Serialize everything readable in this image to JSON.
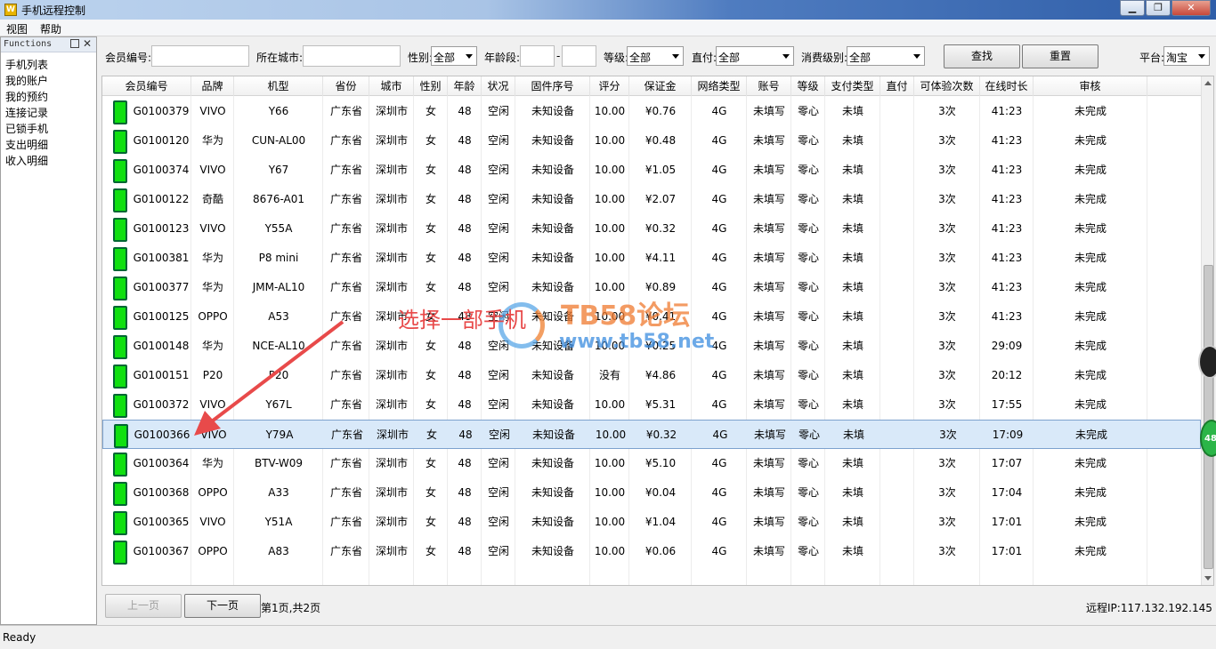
{
  "window": {
    "app_icon_text": "W",
    "title": "手机远程控制"
  },
  "menu": [
    "视图",
    "帮助"
  ],
  "left_panel": {
    "title": "Functions",
    "pin": "",
    "close": "✕",
    "items": [
      "手机列表",
      "我的账户",
      "我的预约",
      "连接记录",
      "已锁手机",
      "支出明细",
      "收入明细"
    ]
  },
  "filters": {
    "member_id_label": "会员编号:",
    "member_id_value": "",
    "city_label": "所在城市:",
    "city_value": "",
    "gender_label": "性别:",
    "gender_value": "全部",
    "age_label": "年龄段:",
    "age_from": "",
    "age_sep": "-",
    "age_to": "",
    "level_label": "等级:",
    "level_value": "全部",
    "direct_pay_label": "直付:",
    "direct_pay_value": "全部",
    "spend_level_label": "消费级别:",
    "spend_level_value": "全部",
    "search_button": "查找",
    "reset_button": "重置",
    "platform_label": "平台:",
    "platform_value": "淘宝"
  },
  "table": {
    "columns": [
      "会员编号",
      "品牌",
      "机型",
      "省份",
      "城市",
      "性别",
      "年龄",
      "状况",
      "固件序号",
      "评分",
      "保证金",
      "网络类型",
      "账号",
      "等级",
      "支付类型",
      "直付",
      "可体验次数",
      "在线时长",
      "审核"
    ],
    "selected_index": 11,
    "rows": [
      [
        "G0100379",
        "VIVO",
        "Y66",
        "广东省",
        "深圳市",
        "女",
        "48",
        "空闲",
        "未知设备",
        "10.00",
        "¥0.76",
        "4G",
        "未填写",
        "零心",
        "未填",
        "",
        "3次",
        "41:23",
        "未完成"
      ],
      [
        "G0100120",
        "华为",
        "CUN-AL00",
        "广东省",
        "深圳市",
        "女",
        "48",
        "空闲",
        "未知设备",
        "10.00",
        "¥0.48",
        "4G",
        "未填写",
        "零心",
        "未填",
        "",
        "3次",
        "41:23",
        "未完成"
      ],
      [
        "G0100374",
        "VIVO",
        "Y67",
        "广东省",
        "深圳市",
        "女",
        "48",
        "空闲",
        "未知设备",
        "10.00",
        "¥1.05",
        "4G",
        "未填写",
        "零心",
        "未填",
        "",
        "3次",
        "41:23",
        "未完成"
      ],
      [
        "G0100122",
        "奇酷",
        "8676-A01",
        "广东省",
        "深圳市",
        "女",
        "48",
        "空闲",
        "未知设备",
        "10.00",
        "¥2.07",
        "4G",
        "未填写",
        "零心",
        "未填",
        "",
        "3次",
        "41:23",
        "未完成"
      ],
      [
        "G0100123",
        "VIVO",
        "Y55A",
        "广东省",
        "深圳市",
        "女",
        "48",
        "空闲",
        "未知设备",
        "10.00",
        "¥0.32",
        "4G",
        "未填写",
        "零心",
        "未填",
        "",
        "3次",
        "41:23",
        "未完成"
      ],
      [
        "G0100381",
        "华为",
        "P8 mini",
        "广东省",
        "深圳市",
        "女",
        "48",
        "空闲",
        "未知设备",
        "10.00",
        "¥4.11",
        "4G",
        "未填写",
        "零心",
        "未填",
        "",
        "3次",
        "41:23",
        "未完成"
      ],
      [
        "G0100377",
        "华为",
        "JMM-AL10",
        "广东省",
        "深圳市",
        "女",
        "48",
        "空闲",
        "未知设备",
        "10.00",
        "¥0.89",
        "4G",
        "未填写",
        "零心",
        "未填",
        "",
        "3次",
        "41:23",
        "未完成"
      ],
      [
        "G0100125",
        "OPPO",
        "A53",
        "广东省",
        "深圳市",
        "女",
        "48",
        "空闲",
        "未知设备",
        "10.00",
        "¥0.41",
        "4G",
        "未填写",
        "零心",
        "未填",
        "",
        "3次",
        "41:23",
        "未完成"
      ],
      [
        "G0100148",
        "华为",
        "NCE-AL10",
        "广东省",
        "深圳市",
        "女",
        "48",
        "空闲",
        "未知设备",
        "10.00",
        "¥0.25",
        "4G",
        "未填写",
        "零心",
        "未填",
        "",
        "3次",
        "29:09",
        "未完成"
      ],
      [
        "G0100151",
        "P20",
        "P20",
        "广东省",
        "深圳市",
        "女",
        "48",
        "空闲",
        "未知设备",
        "没有",
        "¥4.86",
        "4G",
        "未填写",
        "零心",
        "未填",
        "",
        "3次",
        "20:12",
        "未完成"
      ],
      [
        "G0100372",
        "VIVO",
        "Y67L",
        "广东省",
        "深圳市",
        "女",
        "48",
        "空闲",
        "未知设备",
        "10.00",
        "¥5.31",
        "4G",
        "未填写",
        "零心",
        "未填",
        "",
        "3次",
        "17:55",
        "未完成"
      ],
      [
        "G0100366",
        "VIVO",
        "Y79A",
        "广东省",
        "深圳市",
        "女",
        "48",
        "空闲",
        "未知设备",
        "10.00",
        "¥0.32",
        "4G",
        "未填写",
        "零心",
        "未填",
        "",
        "3次",
        "17:09",
        "未完成"
      ],
      [
        "G0100364",
        "华为",
        "BTV-W09",
        "广东省",
        "深圳市",
        "女",
        "48",
        "空闲",
        "未知设备",
        "10.00",
        "¥5.10",
        "4G",
        "未填写",
        "零心",
        "未填",
        "",
        "3次",
        "17:07",
        "未完成"
      ],
      [
        "G0100368",
        "OPPO",
        "A33",
        "广东省",
        "深圳市",
        "女",
        "48",
        "空闲",
        "未知设备",
        "10.00",
        "¥0.04",
        "4G",
        "未填写",
        "零心",
        "未填",
        "",
        "3次",
        "17:04",
        "未完成"
      ],
      [
        "G0100365",
        "VIVO",
        "Y51A",
        "广东省",
        "深圳市",
        "女",
        "48",
        "空闲",
        "未知设备",
        "10.00",
        "¥1.04",
        "4G",
        "未填写",
        "零心",
        "未填",
        "",
        "3次",
        "17:01",
        "未完成"
      ],
      [
        "G0100367",
        "OPPO",
        "A83",
        "广东省",
        "深圳市",
        "女",
        "48",
        "空闲",
        "未知设备",
        "10.00",
        "¥0.06",
        "4G",
        "未填写",
        "零心",
        "未填",
        "",
        "3次",
        "17:01",
        "未完成"
      ]
    ]
  },
  "pager": {
    "prev_button": "上一页",
    "next_button": "下一页",
    "page_info": "第1页,共2页",
    "remote_ip": "远程IP:117.132.192.145"
  },
  "status": "Ready",
  "annotation": {
    "text": "选择一部手机",
    "color": "#e84a4a"
  },
  "watermark": {
    "title": "TB58论坛",
    "url": "www.tb58.net"
  },
  "side_widget_badge": "48",
  "icons": {
    "phone": "phone-icon",
    "colors": {
      "phone": "#10e010",
      "selected_row": "#d9e9f9"
    }
  }
}
